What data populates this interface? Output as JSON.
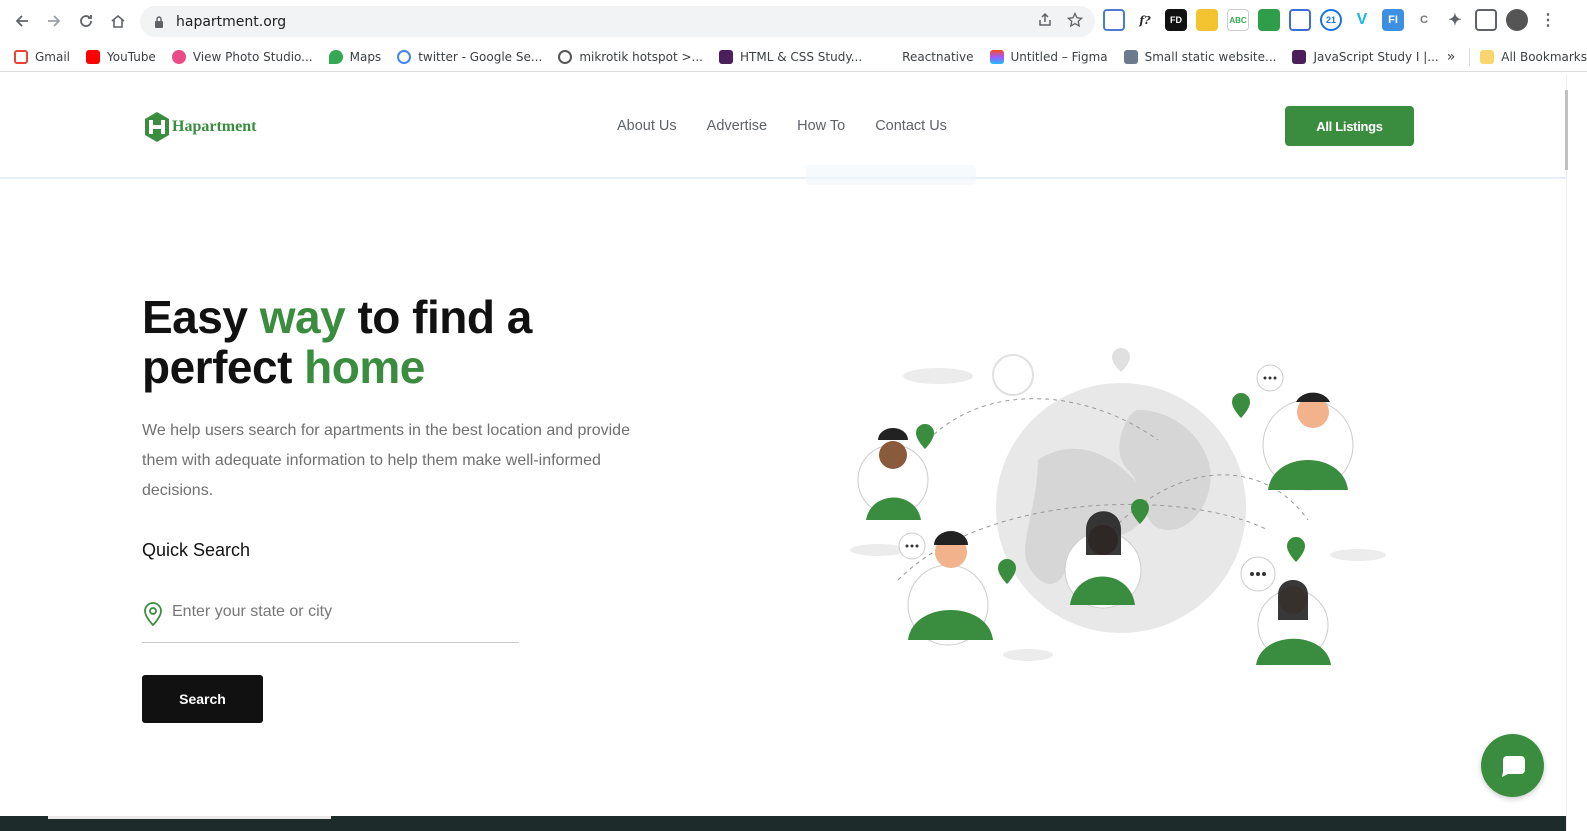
{
  "browser": {
    "url": "hapartment.org",
    "bookmarks": [
      {
        "label": "Gmail",
        "color": "#ea4335"
      },
      {
        "label": "YouTube",
        "color": "#ff0000"
      },
      {
        "label": "View Photo Studio...",
        "color": "#ea4c89"
      },
      {
        "label": "Maps",
        "color": "#34a853"
      },
      {
        "label": "twitter - Google Se...",
        "color": "#4285f4"
      },
      {
        "label": "mikrotik hotspot >...",
        "color": "#555555"
      },
      {
        "label": "HTML & CSS Study...",
        "color": "#4a1f5c"
      },
      {
        "label": "Reactnative",
        "color": "#ffffff"
      },
      {
        "label": "Untitled – Figma",
        "color": "#f24e1e"
      },
      {
        "label": "Small static website...",
        "color": "#6b7b8c"
      },
      {
        "label": "JavaScript Study I |...",
        "color": "#4a1f5c"
      }
    ],
    "bookmarks_overflow": "»",
    "all_bookmarks": "All Bookmarks"
  },
  "site": {
    "logo_text": "Hapartment",
    "nav": [
      "About Us",
      "Advertise",
      "How To",
      "Contact Us"
    ],
    "cta_label": "All Listings",
    "brand_color": "#3a8d3e"
  },
  "hero": {
    "title_part1": "Easy ",
    "title_accent1": "way",
    "title_part2": " to find a",
    "title_part3": "perfect ",
    "title_accent2": "home",
    "description": "We help users search for apartments in the best location and provide them with adequate information to help them make well-informed decisions.",
    "quick_search_label": "Quick Search",
    "search_placeholder": "Enter your state or city",
    "search_button": "Search"
  }
}
